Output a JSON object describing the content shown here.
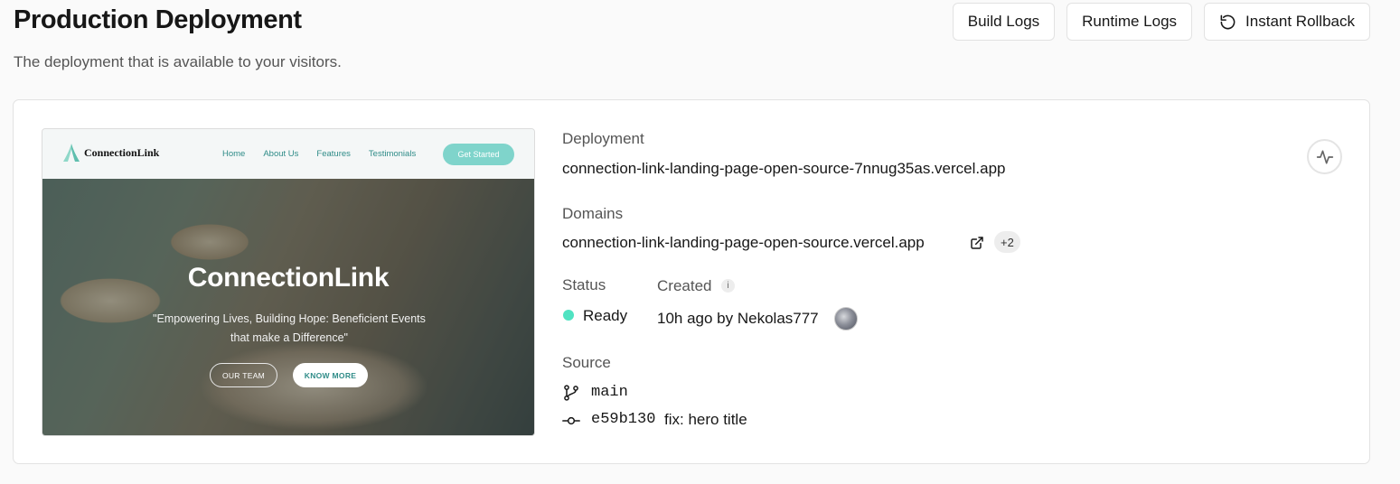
{
  "header": {
    "title": "Production Deployment",
    "subtitle": "The deployment that is available to your visitors.",
    "buttons": {
      "build_logs": "Build Logs",
      "runtime_logs": "Runtime Logs",
      "instant_rollback": "Instant Rollback"
    }
  },
  "preview": {
    "logo_text": "ConnectionLink",
    "nav_links": [
      "Home",
      "About Us",
      "Features",
      "Testimonials"
    ],
    "cta": "Get Started",
    "hero_title": "ConnectionLink",
    "hero_subtitle": "\"Empowering Lives, Building Hope: Beneficient Events that make a Difference\"",
    "hero_button_1": "OUR TEAM",
    "hero_button_2": "KNOW MORE"
  },
  "deployment": {
    "label": "Deployment",
    "url": "connection-link-landing-page-open-source-7nnug35as.vercel.app"
  },
  "domains": {
    "label": "Domains",
    "primary": "connection-link-landing-page-open-source.vercel.app",
    "extra_count": "+2"
  },
  "status": {
    "label": "Status",
    "value": "Ready",
    "color": "#50e3c2"
  },
  "created": {
    "label": "Created",
    "value": "10h ago by Nekolas777"
  },
  "source": {
    "label": "Source",
    "branch": "main",
    "commit_hash": "e59b130",
    "commit_message": "fix: hero title"
  },
  "icons": {
    "rollback": "rotate-ccw-icon",
    "external_link": "external-link-icon",
    "branch": "git-branch-icon",
    "commit": "git-commit-icon",
    "activity": "activity-icon",
    "info": "info-icon"
  }
}
